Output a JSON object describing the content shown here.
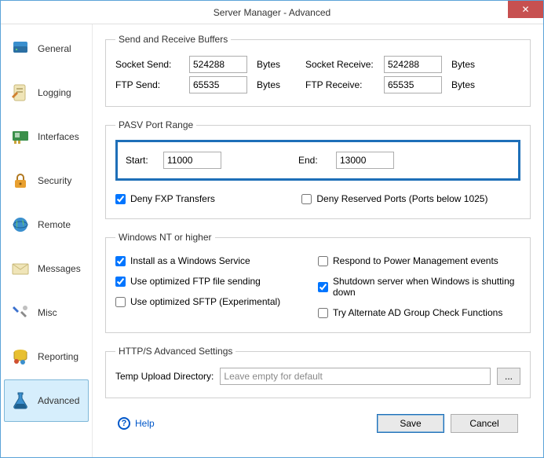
{
  "window": {
    "title": "Server Manager - Advanced"
  },
  "sidebar": {
    "items": [
      {
        "label": "General"
      },
      {
        "label": "Logging"
      },
      {
        "label": "Interfaces"
      },
      {
        "label": "Security"
      },
      {
        "label": "Remote"
      },
      {
        "label": "Messages"
      },
      {
        "label": "Misc"
      },
      {
        "label": "Reporting"
      },
      {
        "label": "Advanced"
      }
    ]
  },
  "buffers": {
    "legend": "Send and Receive Buffers",
    "socket_send_label": "Socket Send:",
    "socket_send": "524288",
    "socket_recv_label": "Socket Receive:",
    "socket_recv": "524288",
    "ftp_send_label": "FTP Send:",
    "ftp_send": "65535",
    "ftp_recv_label": "FTP Receive:",
    "ftp_recv": "65535",
    "unit": "Bytes"
  },
  "pasv": {
    "legend": "PASV Port Range",
    "start_label": "Start:",
    "start": "11000",
    "end_label": "End:",
    "end": "13000",
    "deny_fxp": "Deny FXP Transfers",
    "deny_reserved": "Deny Reserved Ports (Ports below 1025)"
  },
  "nt": {
    "legend": "Windows NT or higher",
    "install_service": "Install as a Windows Service",
    "optimized_ftp": "Use optimized FTP file sending",
    "optimized_sftp": "Use optimized SFTP (Experimental)",
    "respond_power": "Respond to Power Management events",
    "shutdown": "Shutdown server when Windows is shutting down",
    "alt_ad": "Try Alternate AD Group Check Functions"
  },
  "https": {
    "legend": "HTTP/S Advanced Settings",
    "temp_upload_label": "Temp Upload Directory:",
    "temp_upload_placeholder": "Leave empty for default",
    "temp_upload_value": "",
    "browse": "..."
  },
  "footer": {
    "help": "Help",
    "save": "Save",
    "cancel": "Cancel"
  }
}
